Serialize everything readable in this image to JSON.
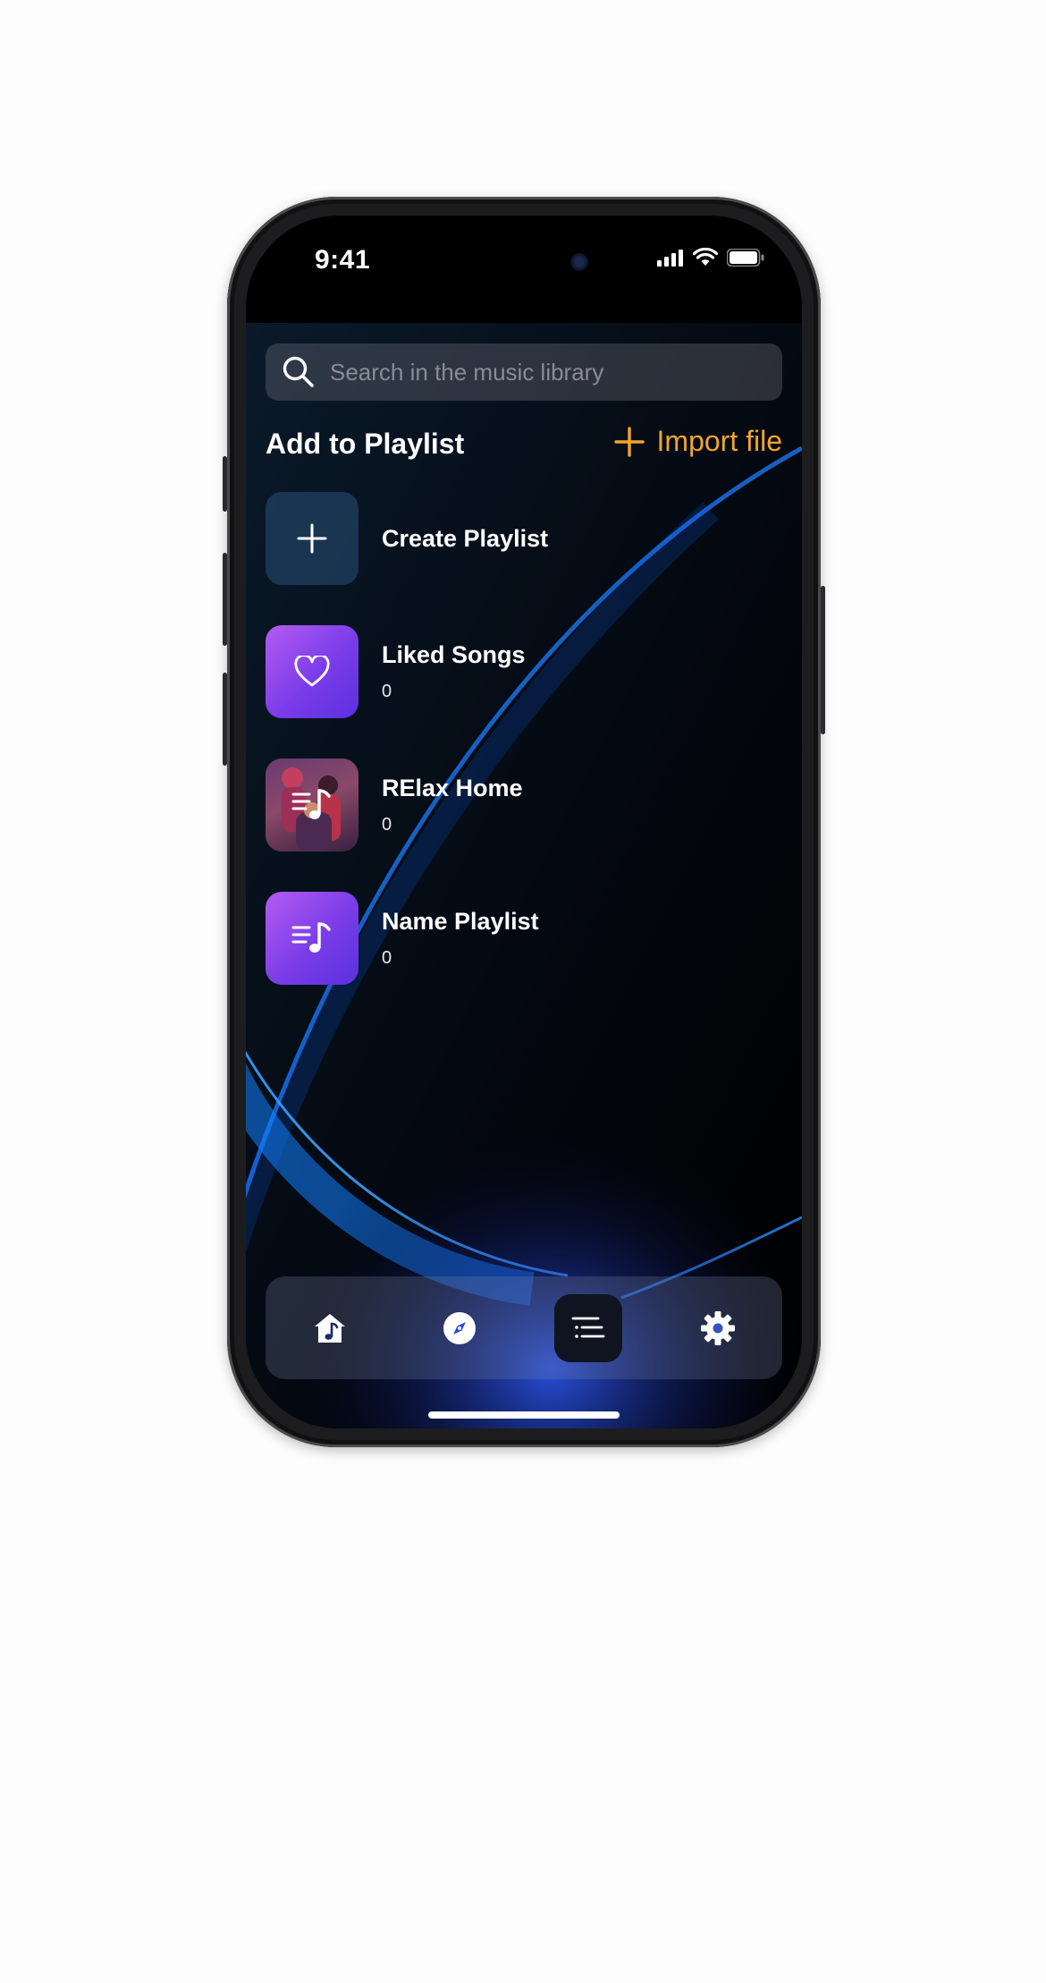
{
  "status_bar": {
    "time": "9:41"
  },
  "search": {
    "placeholder": "Search in the music library",
    "icon": "search-icon"
  },
  "header": {
    "title": "Add to Playlist",
    "import_label": "Import file",
    "import_icon": "plus-icon"
  },
  "playlists": [
    {
      "title": "Create Playlist",
      "icon": "plus-icon"
    },
    {
      "title": "Liked Songs",
      "count": "0",
      "icon": "heart-icon"
    },
    {
      "title": "RElax Home",
      "count": "0",
      "icon": "playlist-music-icon"
    },
    {
      "title": "Name Playlist",
      "count": "0",
      "icon": "playlist-music-icon"
    }
  ],
  "tabbar": {
    "items": [
      {
        "name": "home",
        "icon": "home-music-icon"
      },
      {
        "name": "explore",
        "icon": "compass-icon"
      },
      {
        "name": "playlists",
        "icon": "list-icon",
        "active": true
      },
      {
        "name": "settings",
        "icon": "gear-icon"
      }
    ]
  },
  "colors": {
    "accent": "#f2a52c",
    "purple": "#8a45ec",
    "active_tab": "#0f1420"
  }
}
